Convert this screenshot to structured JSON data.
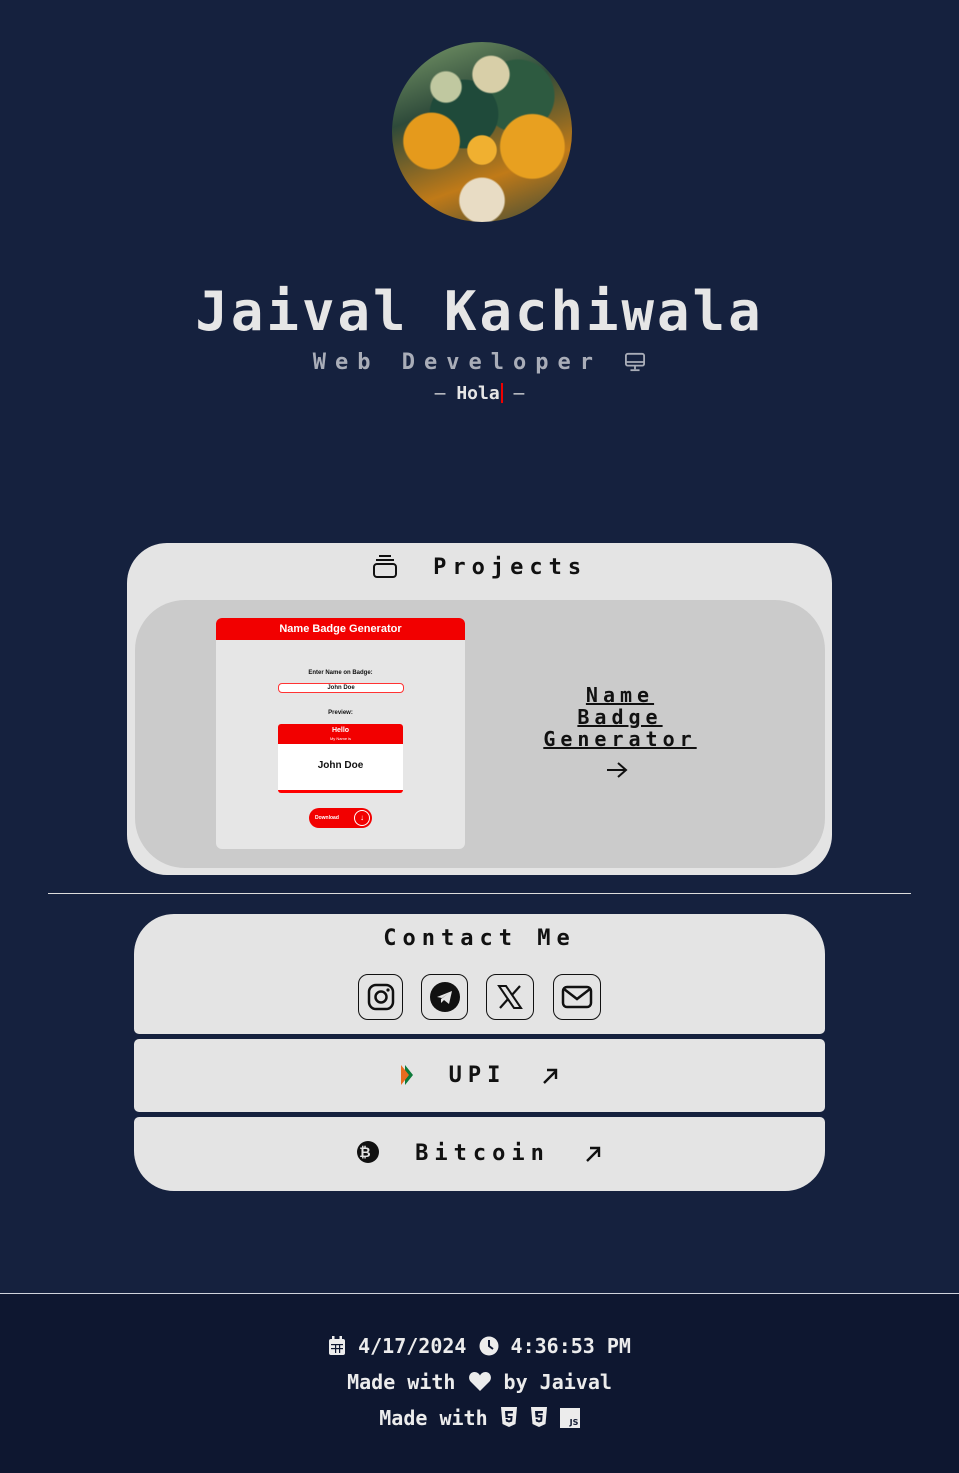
{
  "profile": {
    "name": "Jaival Kachiwala",
    "role": "Web Developer",
    "greeting_prefix": "–",
    "greeting": "Hola",
    "greeting_suffix": "–"
  },
  "projects": {
    "title": "Projects",
    "items": [
      {
        "link_label": "Name Badge Generator",
        "preview": {
          "header": "Name Badge Generator",
          "input_label": "Enter Name on Badge:",
          "input_value": "John Doe",
          "preview_label": "Preview:",
          "badge_hello": "Hello",
          "badge_sub": "My Name is",
          "badge_name": "John Doe",
          "download_label": "Download"
        }
      }
    ]
  },
  "contact": {
    "title": "Contact Me",
    "socials": [
      "instagram-icon",
      "telegram-icon",
      "x-icon",
      "mail-icon"
    ]
  },
  "payments": {
    "upi_label": "UPI",
    "bitcoin_label": "Bitcoin"
  },
  "footer": {
    "date": "4/17/2024",
    "time": "4:36:53 PM",
    "made_with": "Made with",
    "by": "by Jaival",
    "made_with_2": "Made with"
  },
  "colors": {
    "background": "#15213e",
    "card": "#e4e4e4",
    "inner_card": "#cbcbcb",
    "accent_red": "#f20000",
    "footer_bg": "#0e1730"
  }
}
